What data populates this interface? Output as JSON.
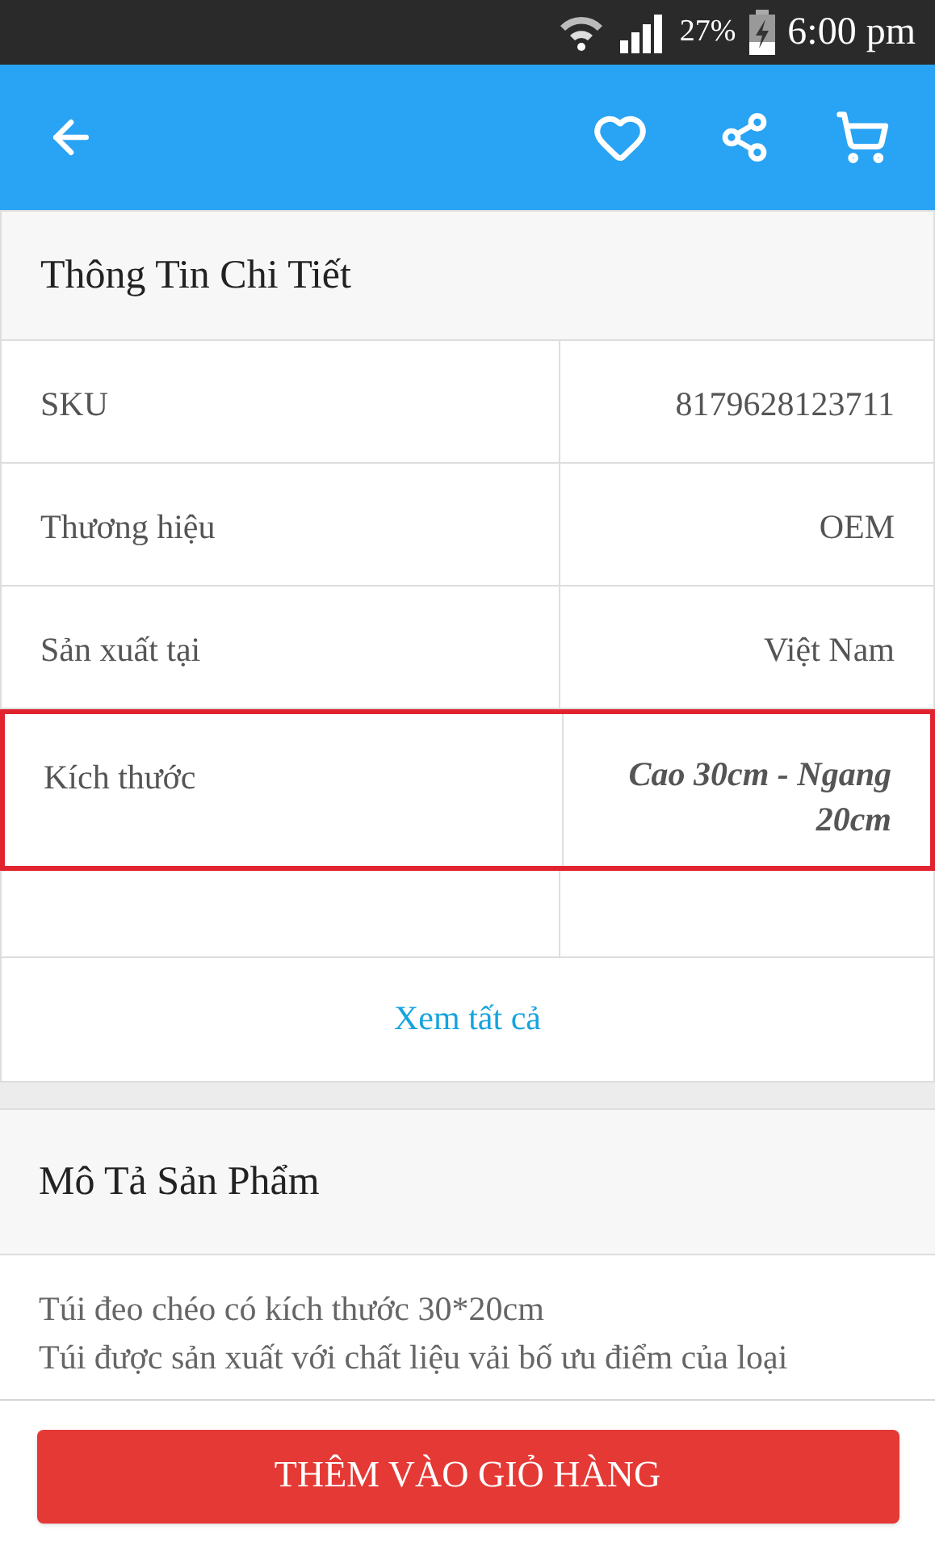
{
  "status_bar": {
    "battery": "27%",
    "time": "6:00 pm"
  },
  "details": {
    "title": "Thông Tin Chi Tiết",
    "rows": [
      {
        "label": "SKU",
        "value": "8179628123711",
        "highlighted": false
      },
      {
        "label": "Thương hiệu",
        "value": "OEM",
        "highlighted": false
      },
      {
        "label": "Sản xuất tại",
        "value": "Việt Nam",
        "highlighted": false
      },
      {
        "label": "Kích thước",
        "value": "Cao 30cm - Ngang 20cm",
        "highlighted": true
      }
    ],
    "see_all": "Xem tất cả"
  },
  "description": {
    "title": "Mô Tả Sản Phẩm",
    "lines": [
      "Túi đeo chéo có kích thước 30*20cm",
      "Túi được sản xuất với chất liệu vải bố ưu điểm của loại"
    ]
  },
  "add_to_cart": "THÊM VÀO GIỎ HÀNG"
}
